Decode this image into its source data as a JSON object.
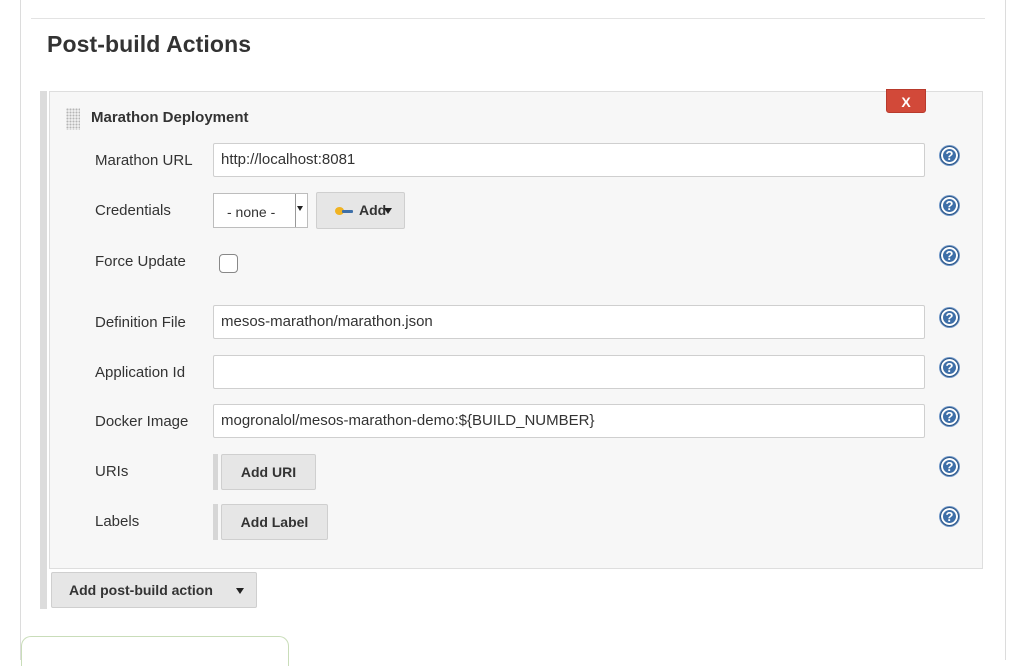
{
  "section": {
    "title": "Post-build Actions"
  },
  "deployment": {
    "title": "Marathon Deployment",
    "close_label": "X",
    "fields": {
      "marathon_url": {
        "label": "Marathon URL",
        "value": "http://localhost:8081"
      },
      "credentials": {
        "label": "Credentials",
        "selected": "- none -",
        "add_label": "Add"
      },
      "force_update": {
        "label": "Force Update",
        "checked": false
      },
      "definition_file": {
        "label": "Definition File",
        "value": "mesos-marathon/marathon.json"
      },
      "application_id": {
        "label": "Application Id",
        "value": ""
      },
      "docker_image": {
        "label": "Docker Image",
        "value": "mogronalol/mesos-marathon-demo:${BUILD_NUMBER}"
      },
      "uris": {
        "label": "URIs",
        "button_label": "Add URI"
      },
      "labels": {
        "label": "Labels",
        "button_label": "Add Label"
      }
    },
    "help_glyph": "?"
  },
  "actions": {
    "add_post_build_label": "Add post-build action"
  },
  "colors": {
    "close_button": "#d24939",
    "help_icon": "#3e6fa8",
    "key_icon": "#f0b322",
    "button_bg": "#e6e6e6",
    "panel_bg": "#f7f7f7"
  },
  "icons": [
    "drag-handle-icon",
    "close-icon",
    "help-icon",
    "key-icon",
    "chevron-down-icon"
  ]
}
